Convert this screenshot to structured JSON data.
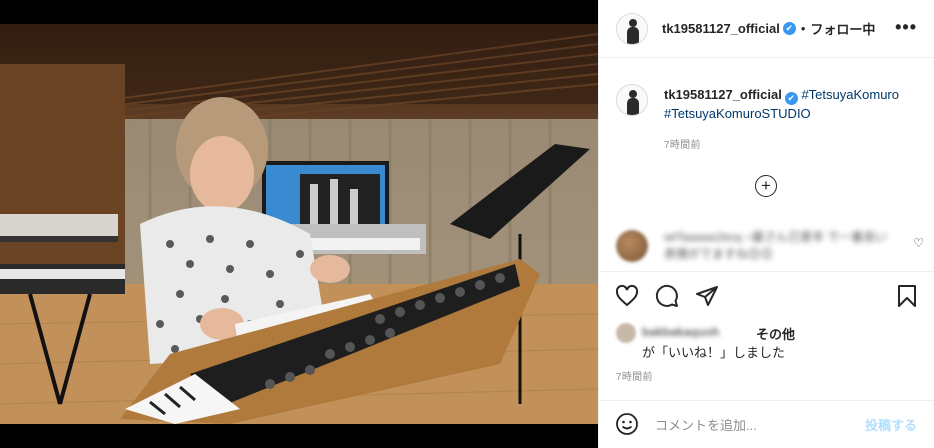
{
  "photo": {
    "alt_subject": "musician-at-synthesizer"
  },
  "header": {
    "username": "tk19581127_official",
    "verified_mark": "✔",
    "separator": "•",
    "follow_state": "フォロー中",
    "more_icon": "•••"
  },
  "caption": {
    "username": "tk19581127_official",
    "hashtags": [
      "#TetsuyaKomuro",
      "#TetsuyaKomuroSTUDIO"
    ],
    "time_ago": "7時間前"
  },
  "load_more_icon": "+",
  "comment": {
    "blurred_text": "wtTaaaaa1bcq ○最さん已意羊 で一番良い表情がでますね😊😊",
    "heart_icon": "♡"
  },
  "likes": {
    "blurred_username": "bakbakaquoh",
    "others_label": "その他",
    "liked_text": "が「いいね！」しました"
  },
  "post_time_ago": "7時間前",
  "add_comment": {
    "placeholder": "コメントを追加...",
    "post_label": "投稿する"
  },
  "colors": {
    "verified": "#3897f0",
    "hashtag": "#00376b",
    "post_disabled": "#b2dffc",
    "muted": "#8e8e8e"
  }
}
